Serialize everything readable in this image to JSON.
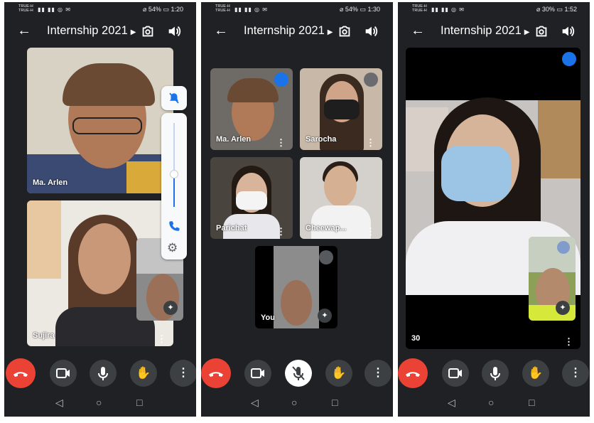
{
  "status": [
    {
      "carrier": "TRUE-H\nTRUE-H",
      "battery": "54%",
      "time": "1:20"
    },
    {
      "carrier": "TRUE-H\nTRUE-H",
      "battery": "54%",
      "time": "1:30"
    },
    {
      "carrier": "TRUE-H\nTRUE-H",
      "battery": "30%",
      "time": "1:52"
    }
  ],
  "meeting": {
    "title": "Internship 2021"
  },
  "screen1": {
    "tiles": [
      {
        "name": "Ma. Arlen"
      },
      {
        "name": "Sujira"
      }
    ]
  },
  "screen2": {
    "tiles": [
      {
        "name": "Ma. Arlen"
      },
      {
        "name": "Sarocha"
      },
      {
        "name": "Parichat"
      },
      {
        "name": "Cheewap..."
      },
      {
        "name": "You"
      }
    ]
  },
  "screen3": {
    "label": "30"
  },
  "icons": {
    "back": "back-arrow-icon",
    "switch_camera": "switch-camera-icon",
    "audio": "speaker-icon",
    "end_call": "end-call-icon",
    "camera": "camera-icon",
    "mic": "mic-icon",
    "raise_hand": "raise-hand-icon",
    "more": "more-vert-icon"
  },
  "colors": {
    "bg": "#202124",
    "end": "#ea4335",
    "accent": "#1a73e8"
  }
}
